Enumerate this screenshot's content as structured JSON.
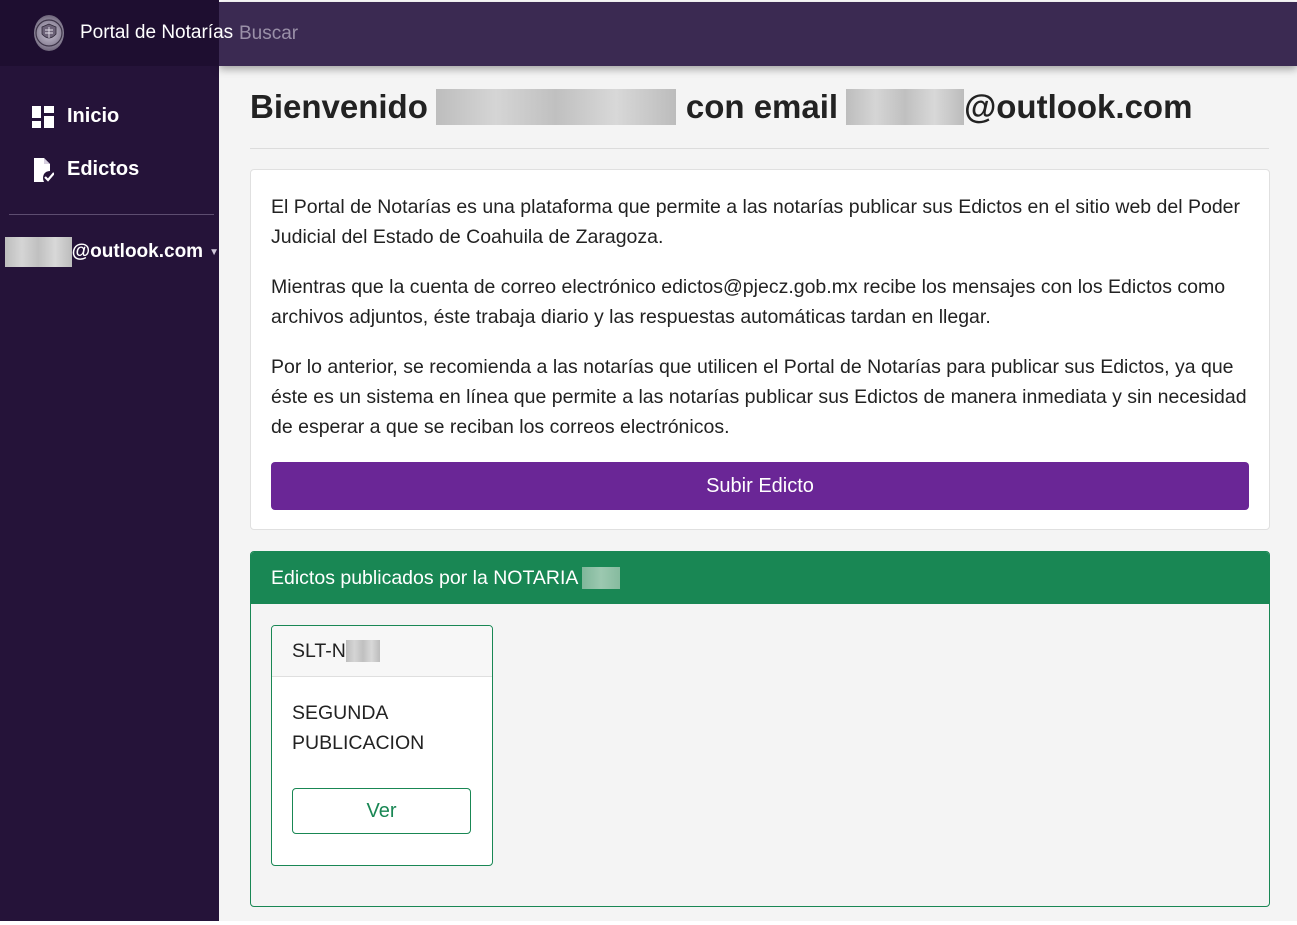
{
  "app": {
    "title": "Portal de Notarías",
    "logo_icon": "coat-of-arms-icon"
  },
  "search": {
    "placeholder": "Buscar",
    "value": ""
  },
  "sidebar": {
    "items": [
      {
        "label": "Inicio",
        "icon": "dashboard-icon"
      },
      {
        "label": "Edictos",
        "icon": "file-check-icon"
      }
    ],
    "user_email_suffix": "@outlook.com",
    "user_caret_icon": "caret-down-icon"
  },
  "main": {
    "welcome_prefix": "Bienvenido",
    "welcome_middle": "con email",
    "welcome_email_suffix": "@outlook.com",
    "info_paragraphs": [
      "El Portal de Notarías es una plataforma que permite a las notarías publicar sus Edictos en el sitio web del Poder Judicial del Estado de Coahuila de Zaragoza.",
      "Mientras que la cuenta de correo electrónico edictos@pjecz.gob.mx recibe los mensajes con los Edictos como archivos adjuntos, éste trabaja diario y las respuestas automáticas tardan en llegar.",
      "Por lo anterior, se recomienda a las notarías que utilicen el Portal de Notarías para publicar sus Edictos, ya que éste es un sistema en línea que permite a las notarías publicar sus Edictos de manera inmediata y sin necesidad de esperar a que se reciban los correos electrónicos."
    ],
    "upload_button": "Subir Edicto",
    "edictos_header": "Edictos publicados por la NOTARIA",
    "edictos": [
      {
        "code_prefix": "SLT-N",
        "description": "SEGUNDA PUBLICACION",
        "button": "Ver"
      }
    ]
  },
  "colors": {
    "sidebar_bg": "#251339",
    "topbar_bg": "#3b2a52",
    "primary_purple": "#6a2696",
    "success_green": "#198754"
  }
}
